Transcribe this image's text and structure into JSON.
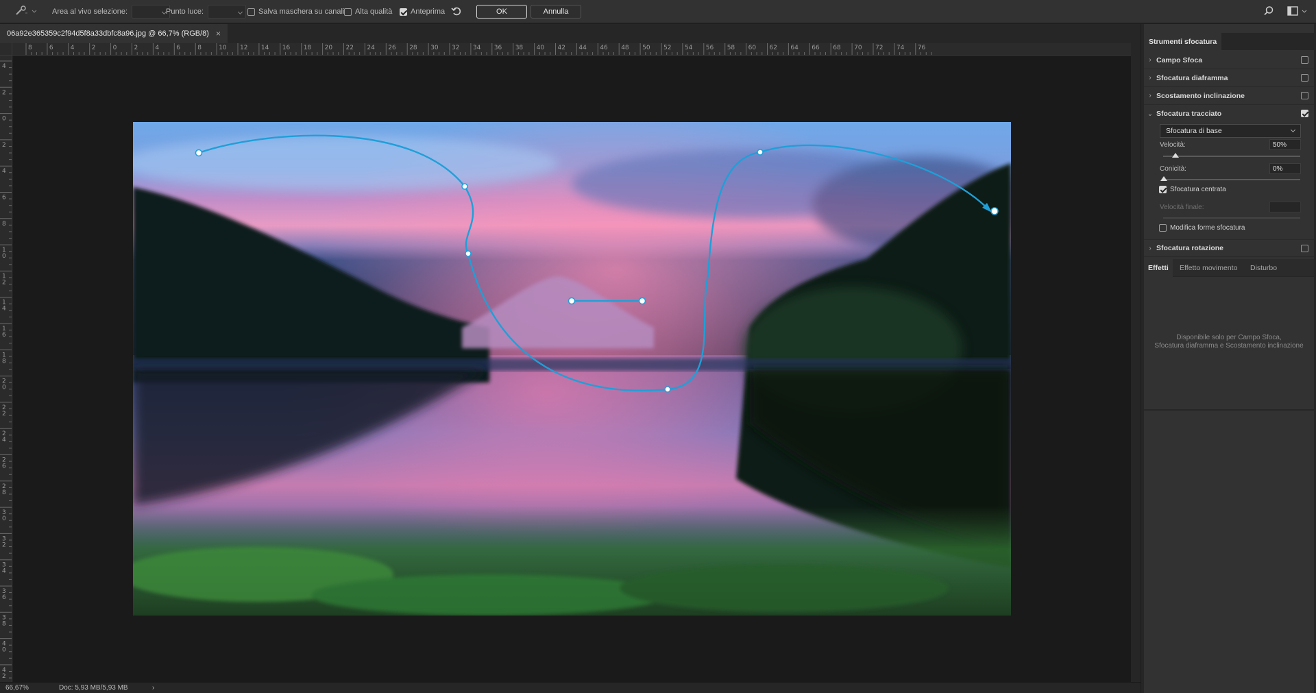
{
  "options_bar": {
    "live_area_label": "Area al vivo selezione:",
    "highlight_label": "Punto luce:",
    "save_mask_label": "Salva maschera su canali",
    "save_mask_checked": false,
    "high_quality_label": "Alta qualità",
    "high_quality_checked": false,
    "preview_label": "Anteprima",
    "preview_checked": true,
    "ok_label": "OK",
    "cancel_label": "Annulla"
  },
  "document": {
    "tab_title": "06a92e365359c2f94d5f8a33dbfc8a96.jpg @ 66,7% (RGB/8)",
    "close_glyph": "×"
  },
  "rulers": {
    "horizontal": [
      "8",
      "6",
      "4",
      "2",
      "0",
      "2",
      "4",
      "6",
      "8",
      "10",
      "12",
      "14",
      "16",
      "18",
      "20",
      "22",
      "24",
      "26",
      "28",
      "30",
      "32",
      "34",
      "36",
      "38",
      "40",
      "42",
      "44",
      "46",
      "48",
      "50",
      "52",
      "54",
      "56",
      "58",
      "60",
      "62",
      "64",
      "66",
      "68",
      "70",
      "72",
      "74",
      "76"
    ],
    "vertical": [
      "4",
      "2",
      "0",
      "2",
      "4",
      "6",
      "8",
      "10",
      "12",
      "14",
      "16",
      "18",
      "20",
      "22",
      "24",
      "26",
      "28",
      "30",
      "32",
      "34",
      "36",
      "38",
      "40",
      "42"
    ]
  },
  "status": {
    "zoom": "66,67%",
    "doc_size": "Doc: 5,93 MB/5,93 MB",
    "arrow": "›"
  },
  "panel": {
    "tab_label": "Strumenti sfocatura",
    "sections": [
      {
        "label": "Campo Sfoca",
        "expanded": false,
        "checked": false
      },
      {
        "label": "Sfocatura diaframma",
        "expanded": false,
        "checked": false
      },
      {
        "label": "Scostamento inclinazione",
        "expanded": false,
        "checked": false
      },
      {
        "label": "Sfocatura tracciato",
        "expanded": true,
        "checked": true
      },
      {
        "label": "Sfocatura rotazione",
        "expanded": false,
        "checked": false
      }
    ],
    "path_blur": {
      "type_value": "Sfocatura di base",
      "speed_label": "Velocità:",
      "speed_value": "50%",
      "speed": 0.5,
      "taper_label": "Conicità:",
      "taper_value": "0%",
      "taper": 0.0,
      "centered_label": "Sfocatura centrata",
      "centered_checked": true,
      "end_speed_label": "Velocità finale:",
      "edit_shapes_label": "Modifica forme sfocatura",
      "edit_shapes_checked": false
    },
    "effects_tabs": [
      "Effetti",
      "Effetto movimento",
      "Disturbo"
    ],
    "effects_active": "Effetti",
    "effects_note_line1": "Disponibile solo per Campo Sfoca,",
    "effects_note_line2": "Sfocatura diaframma e Scostamento inclinazione"
  },
  "colors": {
    "accent_path": "#1f9fd8",
    "panel_bg": "#323232",
    "app_bg": "#1e1e1e"
  },
  "icons": {
    "tool": "path-blur-tool-icon",
    "reset": "reset-arrow-icon",
    "search": "search-icon",
    "workspace": "workspace-layout-icon",
    "collapse": "collapse-panel-icon"
  }
}
